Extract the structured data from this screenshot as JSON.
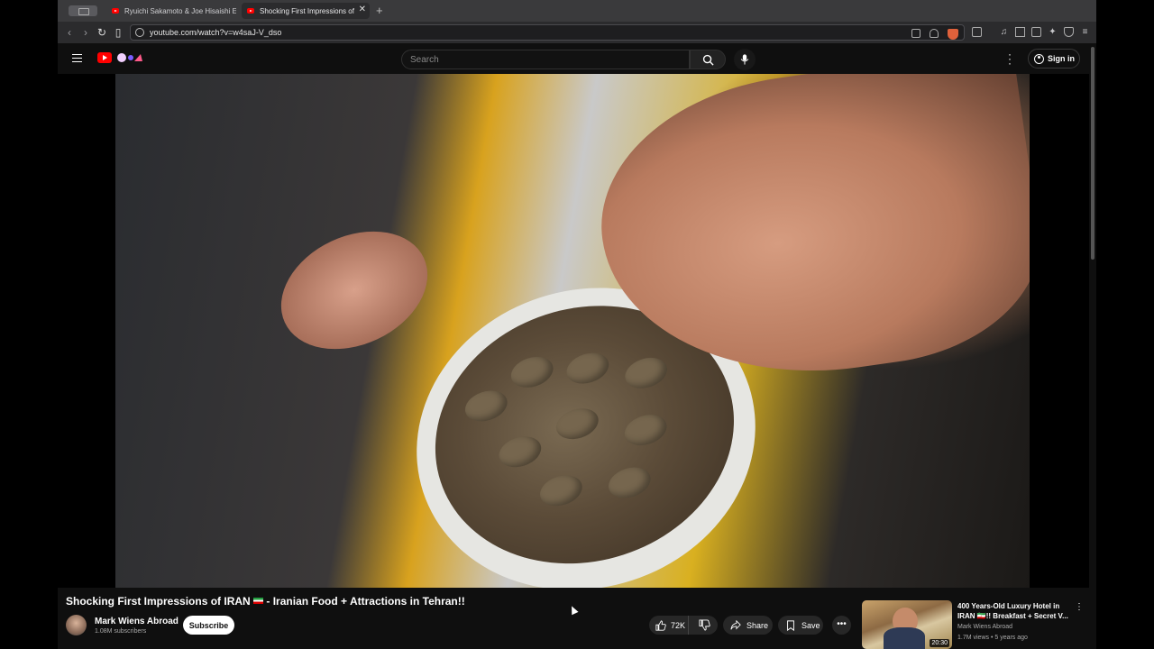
{
  "browser": {
    "tabs": [
      {
        "title": "Ryuichi Sakamoto & Joe Hisaishi E"
      },
      {
        "title": "Shocking First Impressions of"
      }
    ],
    "url": "youtube.com/watch?v=w4saJ-V_dso"
  },
  "header": {
    "search_placeholder": "Search",
    "signin_label": "Sign in"
  },
  "video": {
    "title": "Shocking First Impressions of IRAN",
    "title_suffix": " - Iranian Food + Attractions in Tehran!!",
    "channel": "Mark Wiens Abroad",
    "subscribers": "1.08M subscribers",
    "subscribe_label": "Subscribe",
    "likes": "72K",
    "share_label": "Share",
    "save_label": "Save"
  },
  "recommendation": {
    "title": "400 Years-Old Luxury Hotel in IRAN 🇮🇷!! Breakfast + Secret V...",
    "channel": "Mark Wiens Abroad",
    "meta": "1.7M views • 5 years ago",
    "duration": "20:30"
  },
  "colors": {
    "accent": "#ff0000",
    "background": "#0f0f0f",
    "pill": "#272727"
  },
  "icons": [
    "hamburger-icon",
    "youtube-logo",
    "search-icon",
    "mic-icon",
    "kebab-icon",
    "account-icon",
    "like-icon",
    "dislike-icon",
    "share-icon",
    "save-icon",
    "more-icon"
  ]
}
